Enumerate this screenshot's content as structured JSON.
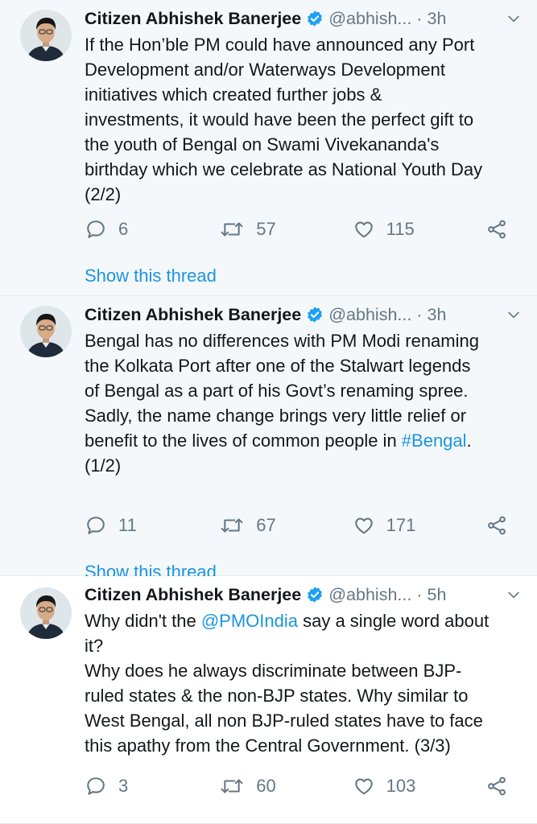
{
  "tweets": [
    {
      "name": "Citizen Abhishek Banerjee",
      "handle": "@abhish...",
      "dot": "·",
      "time": "3h",
      "text": "If the Hon’ble PM could have announced any Port\nDevelopment and/or Waterways Development\ninitiatives which created further jobs &\ninvestments, it would have been the perfect gift to\nthe youth of Bengal on Swami Vivekananda's\nbirthday which we celebrate as National Youth Day\n(2/2)",
      "replies": "6",
      "retweets": "57",
      "likes": "115",
      "thread_link": "Show this thread"
    },
    {
      "name": "Citizen Abhishek Banerjee",
      "handle": "@abhish...",
      "dot": "·",
      "time": "3h",
      "text_before": "Bengal has no differences with PM Modi renaming\nthe Kolkata Port after one of the Stalwart legends\nof Bengal as a part of his Govt’s renaming spree.\nSadly, the name change brings very little relief or\nbenefit to the lives of common people in ",
      "hashtag": "#Bengal",
      "text_after": ".\n(1/2)",
      "replies": "11",
      "retweets": "67",
      "likes": "171",
      "thread_link": "Show this thread"
    },
    {
      "name": "Citizen Abhishek Banerjee",
      "handle": "@abhish...",
      "dot": "·",
      "time": "5h",
      "text_before": "Why didn't the ",
      "mention": "@PMOIndia",
      "text_after": " say a single word about\nit?\nWhy does he always discriminate between BJP-\nruled states & the non-BJP states. Why similar to\nWest Bengal, all non BJP-ruled states have to face\nthis apathy from the Central Government. (3/3)",
      "replies": "3",
      "retweets": "60",
      "likes": "103"
    }
  ],
  "colors": {
    "link": "#1b95e0",
    "secondary": "#657786",
    "verified": "#1da1f2",
    "thread_bg": "#f5f8fa"
  },
  "icons": [
    "verified-badge-icon",
    "chevron-down-icon",
    "reply-icon",
    "retweet-icon",
    "like-icon",
    "share-icon"
  ]
}
